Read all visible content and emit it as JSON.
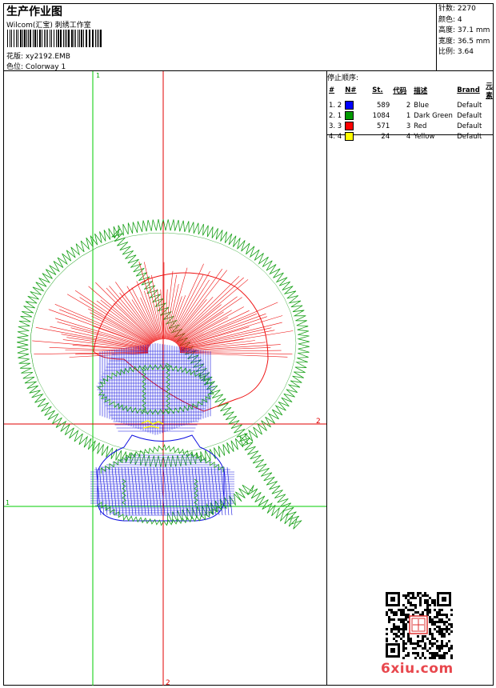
{
  "header": {
    "title": "生产作业图",
    "company": "Wilcom(汇宝) 刺绣工作室",
    "design_label": "花版:",
    "design_file": "xy2192.EMB",
    "colorway_label": "色位:",
    "colorway": "Colorway 1"
  },
  "stats": [
    {
      "label": "针数:",
      "value": "2270"
    },
    {
      "label": "颜色:",
      "value": "4"
    },
    {
      "label": "高度:",
      "value": "37.1 mm"
    },
    {
      "label": "宽度:",
      "value": "36.5 mm"
    },
    {
      "label": "比例:",
      "value": "3.64"
    }
  ],
  "stop_sequence": {
    "title": "停止顺序:",
    "headers": {
      "index": "#",
      "n": "N#",
      "st": "St.",
      "code": "代码",
      "desc": "描述",
      "brand": "Brand",
      "element": "元素"
    },
    "rows": [
      {
        "index": "1. 2",
        "color": "#0000ff",
        "st": "589",
        "code": "2",
        "desc": "Blue",
        "brand": "Default"
      },
      {
        "index": "2. 1",
        "color": "#009a00",
        "st": "1084",
        "code": "1",
        "desc": "Dark Green",
        "brand": "Default"
      },
      {
        "index": "3. 3",
        "color": "#ff0000",
        "st": "571",
        "code": "3",
        "desc": "Red",
        "brand": "Default"
      },
      {
        "index": "4. 4",
        "color": "#ffff00",
        "st": "24",
        "code": "4",
        "desc": "Yellow",
        "brand": "Default"
      }
    ]
  },
  "guides": {
    "v1": "1",
    "h1": "1",
    "h2": "2",
    "v2": "2"
  },
  "watermark": "6xiu.com",
  "colors": {
    "green": "#1aa11a",
    "blue": "#1010e0",
    "red": "#ee1111",
    "yellow": "#ffff00",
    "guide_green": "#00cc00",
    "guide_red": "#e00000"
  }
}
